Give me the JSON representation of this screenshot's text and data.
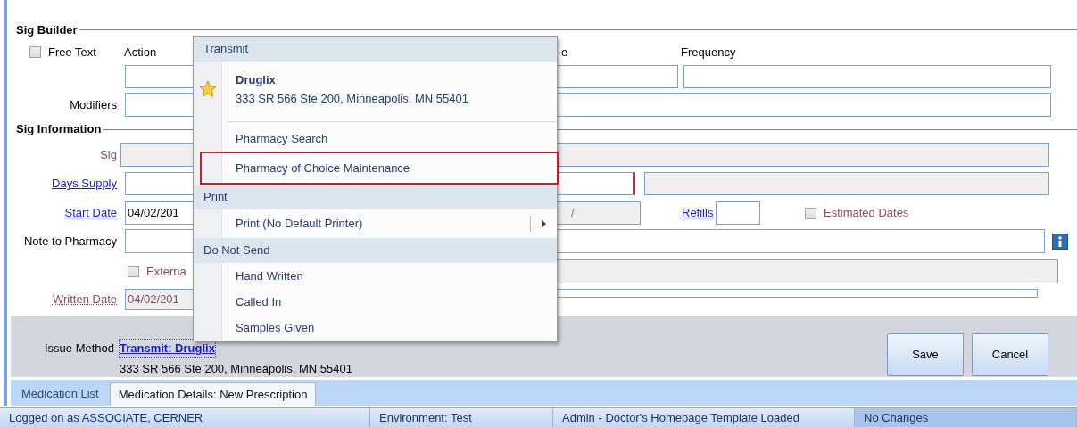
{
  "sig_builder": {
    "title": "Sig Builder",
    "free_text": {
      "label": "Free Text",
      "checked": false
    },
    "labels": [
      "Action",
      "e",
      "Frequency"
    ],
    "modifiers_label": "Modifiers"
  },
  "sig_information": {
    "title": "Sig Information",
    "sig_label": "Sig",
    "days_supply_label": "Days Supply",
    "start_date_label": "Start Date",
    "start_date_value": "04/02/201",
    "end_date_fragment": "/",
    "refills_label": "Refills",
    "estimated_dates": {
      "label": "Estimated Dates",
      "checked": false
    },
    "note_label": "Note to Pharmacy",
    "external": {
      "label": "Externa",
      "checked": false
    },
    "written_date_label": "Written Date",
    "written_date_value": "04/02/201"
  },
  "issue": {
    "label": "Issue Method",
    "link": "Transmit: Druglix",
    "address": "333 SR 566 Ste 200, Minneapolis, MN 55401"
  },
  "buttons": [
    "Save",
    "Cancel"
  ],
  "tabs": [
    {
      "label": "Medication List",
      "selected": false
    },
    {
      "label": "Medication Details: New Prescription",
      "selected": true
    }
  ],
  "status_bar": [
    "Logged on as ASSOCIATE, CERNER",
    "Environment: Test",
    "Admin - Doctor's Homepage Template Loaded",
    "No Changes"
  ],
  "menu": [
    {
      "kind": "header",
      "label": "Transmit"
    },
    {
      "kind": "pharmacy",
      "name": "Druglix",
      "address": "333 SR 566 Ste 200, Minneapolis, MN 55401"
    },
    {
      "kind": "separator"
    },
    {
      "kind": "item",
      "label": "Pharmacy Search",
      "highlighted": false
    },
    {
      "kind": "item",
      "label": "Pharmacy of Choice Maintenance",
      "highlighted": true
    },
    {
      "kind": "header",
      "label": "Print"
    },
    {
      "kind": "submenu",
      "label": "Print (No Default Printer)"
    },
    {
      "kind": "header",
      "label": "Do Not Send"
    },
    {
      "kind": "item",
      "label": "Hand Written",
      "highlighted": false
    },
    {
      "kind": "item",
      "label": "Called In",
      "highlighted": false
    },
    {
      "kind": "item",
      "label": "Samples Given",
      "highlighted": false
    }
  ]
}
